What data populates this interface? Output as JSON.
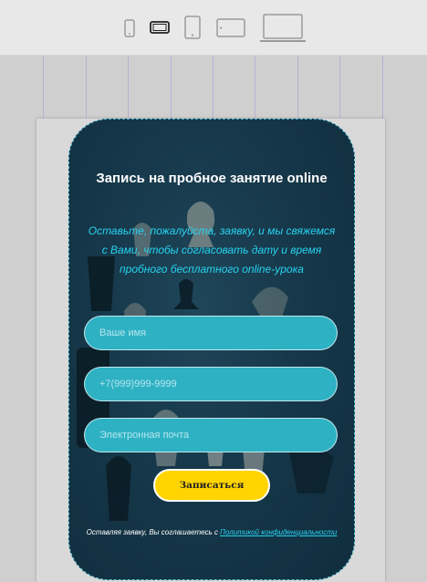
{
  "toolbar": {
    "devices": [
      {
        "name": "phone-portrait",
        "active": false
      },
      {
        "name": "phone-landscape",
        "active": true
      },
      {
        "name": "tablet-portrait",
        "active": false
      },
      {
        "name": "tablet-landscape",
        "active": false
      },
      {
        "name": "laptop",
        "active": false
      }
    ]
  },
  "form": {
    "title": "Запись на пробное занятие online",
    "subtitle": "Оставьте, пожалуйста, заявку, и мы свяжемся с Вами, чтобы согласовать дату и время пробного бесплатного online-урока",
    "name_placeholder": "Ваше имя",
    "phone_placeholder": "+7(999)999-9999",
    "email_placeholder": "Электронная почта",
    "submit_label": "Записаться",
    "consent_text": "Оставляя заявку, Вы соглашаетесь с ",
    "consent_link": "Политикой конфиденциальности"
  },
  "colors": {
    "accent_cyan": "#27d3f0",
    "field_bg": "#2eb1c3",
    "button_bg": "#ffd400",
    "card_bg": "#16384a"
  }
}
